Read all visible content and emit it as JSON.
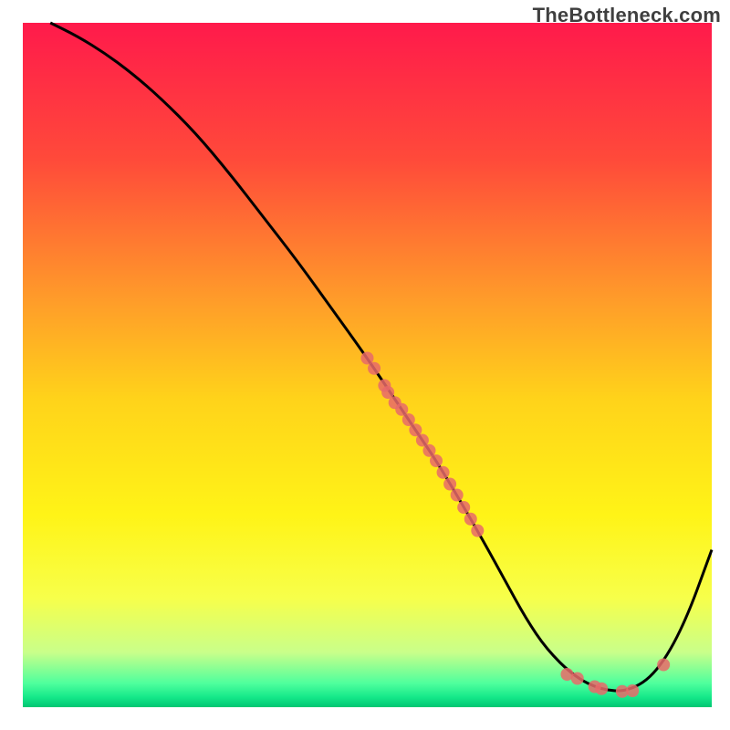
{
  "watermark": "TheBottleneck.com",
  "chart_data": {
    "type": "line",
    "title": "",
    "xlabel": "",
    "ylabel": "",
    "xlim": [
      0,
      100
    ],
    "ylim": [
      0,
      100
    ],
    "x_axis_visible": false,
    "y_axis_visible": false,
    "grid": false,
    "legend": false,
    "background_gradient": {
      "stops": [
        {
          "offset": 0.0,
          "color": "#ff1a4b"
        },
        {
          "offset": 0.2,
          "color": "#ff4a3a"
        },
        {
          "offset": 0.4,
          "color": "#ff9a2a"
        },
        {
          "offset": 0.55,
          "color": "#ffd31a"
        },
        {
          "offset": 0.72,
          "color": "#fff417"
        },
        {
          "offset": 0.84,
          "color": "#f7ff4a"
        },
        {
          "offset": 0.92,
          "color": "#c9ff8a"
        },
        {
          "offset": 0.965,
          "color": "#4fff9d"
        },
        {
          "offset": 0.985,
          "color": "#16e98a"
        },
        {
          "offset": 1.0,
          "color": "#00c572"
        }
      ]
    },
    "series": [
      {
        "name": "bottleneck-curve",
        "stroke": "#000000",
        "x": [
          4,
          8,
          12,
          16,
          20,
          25,
          30,
          35,
          40,
          45,
          50,
          55,
          58,
          60,
          63,
          67,
          70,
          73,
          76,
          80,
          84,
          88,
          92,
          96,
          100
        ],
        "y": [
          100,
          98,
          95.5,
          92.5,
          89,
          84,
          78,
          71.5,
          65,
          58,
          51,
          43.5,
          39,
          36,
          31,
          24,
          18.5,
          13,
          8.5,
          4.5,
          2.5,
          2.3,
          5,
          12,
          23
        ]
      }
    ],
    "scatter_points": {
      "name": "marker-cluster",
      "fill": "#e86a6a",
      "points": [
        {
          "x": 50,
          "y": 51
        },
        {
          "x": 51,
          "y": 49.5
        },
        {
          "x": 52.5,
          "y": 47
        },
        {
          "x": 53,
          "y": 46
        },
        {
          "x": 54,
          "y": 44.5
        },
        {
          "x": 55,
          "y": 43.5
        },
        {
          "x": 56,
          "y": 42
        },
        {
          "x": 57,
          "y": 40.5
        },
        {
          "x": 58,
          "y": 39
        },
        {
          "x": 59,
          "y": 37.5
        },
        {
          "x": 60,
          "y": 36
        },
        {
          "x": 61,
          "y": 34.3
        },
        {
          "x": 62,
          "y": 32.6
        },
        {
          "x": 63,
          "y": 31
        },
        {
          "x": 64,
          "y": 29.2
        },
        {
          "x": 65,
          "y": 27.5
        },
        {
          "x": 66,
          "y": 25.8
        },
        {
          "x": 79,
          "y": 4.8
        },
        {
          "x": 80.5,
          "y": 4.2
        },
        {
          "x": 83,
          "y": 3.0
        },
        {
          "x": 84,
          "y": 2.7
        },
        {
          "x": 87,
          "y": 2.3
        },
        {
          "x": 88.5,
          "y": 2.4
        },
        {
          "x": 93,
          "y": 6.2
        }
      ]
    }
  }
}
